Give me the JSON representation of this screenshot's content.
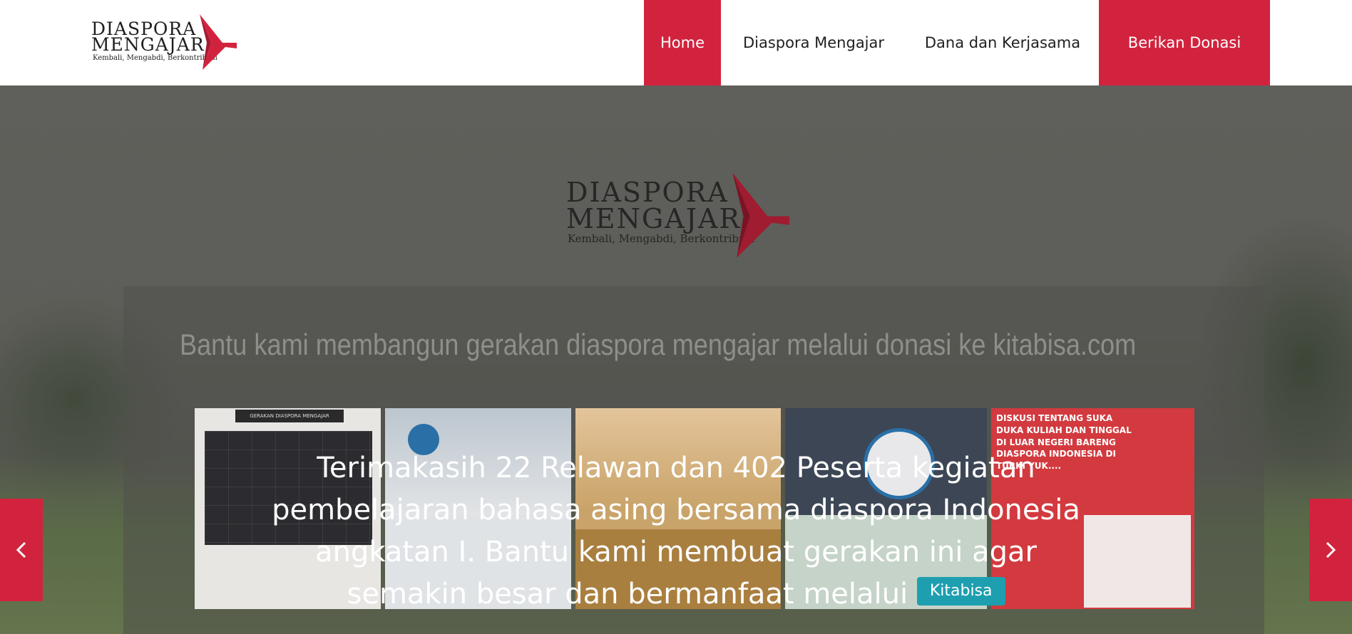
{
  "header": {
    "logo": {
      "line1": "DIASPORA",
      "line2": "MENGAJAR",
      "tagline": "Kembali, Mengabdi, Berkontribusi"
    },
    "nav": {
      "home": "Home",
      "diaspora_mengajar": "Diaspora Mengajar",
      "dana_kerjasama": "Dana dan Kerjasama",
      "donate": "Berikan Donasi"
    }
  },
  "hero": {
    "logo": {
      "line1": "DIASPORA",
      "line2": "MENGAJAR",
      "tagline": "Kembali, Mengabdi, Berkontribusi"
    },
    "panel_title": "Bantu kami membangun gerakan diaspora mengajar  melalui  donasi ke kitabisa.com",
    "card1_header": "GERAKAN DIASPORA MENGAJAR",
    "card5_text": "DISKUSI TENTANG SUKA DUKA KULIAH DAN TINGGAL DI LUAR NEGERI BARENG DIASPORA INDONESIA DI TURKI YUK....",
    "overlay_text": "Terimakasih 22 Relawan dan 402 Peserta kegiatan pembelajaran bahasa asing bersama diaspora Indonesia angkatan I. Bantu kami membuat gerakan ini agar semakin besar dan bermanfaat melalui",
    "kitabisa_button": "Kitabisa",
    "prev_icon": "chevron-left-icon",
    "next_icon": "chevron-right-icon"
  },
  "colors": {
    "brand_red": "#d2233e",
    "kitabisa_teal": "#1d9fb0"
  }
}
